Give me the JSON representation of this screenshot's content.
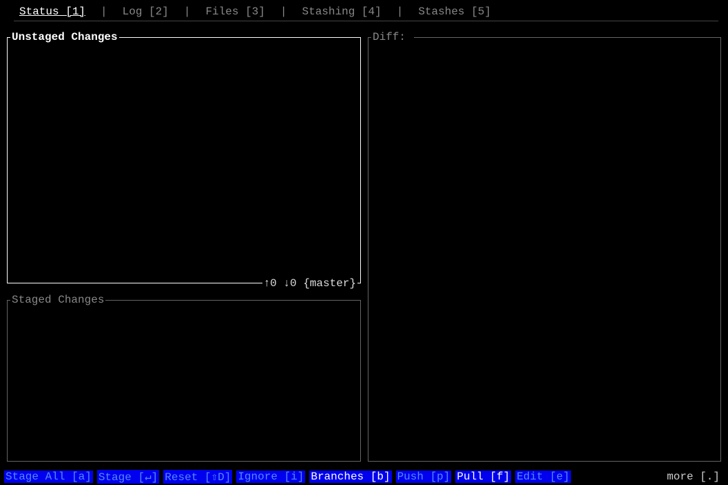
{
  "tabs": {
    "items": [
      {
        "label": "Status [1]",
        "active": true
      },
      {
        "label": "Log [2]",
        "active": false
      },
      {
        "label": "Files [3]",
        "active": false
      },
      {
        "label": "Stashing [4]",
        "active": false
      },
      {
        "label": "Stashes [5]",
        "active": false
      }
    ],
    "separator": "|"
  },
  "panels": {
    "unstaged": {
      "title": "Unstaged Changes"
    },
    "staged": {
      "title": "Staged Changes"
    },
    "diff": {
      "title": "Diff: "
    }
  },
  "branch_status": "↑0 ↓0 {master}",
  "commands": [
    {
      "label": "Stage All [a]",
      "enabled": false
    },
    {
      "label": "Stage [↵]",
      "enabled": false
    },
    {
      "label": "Reset [⇧D]",
      "enabled": false
    },
    {
      "label": "Ignore [i]",
      "enabled": false
    },
    {
      "label": "Branches [b]",
      "enabled": true
    },
    {
      "label": "Push [p]",
      "enabled": false
    },
    {
      "label": "Pull [f]",
      "enabled": true
    },
    {
      "label": "Edit [e]",
      "enabled": false
    }
  ],
  "more_label": "more [.]"
}
